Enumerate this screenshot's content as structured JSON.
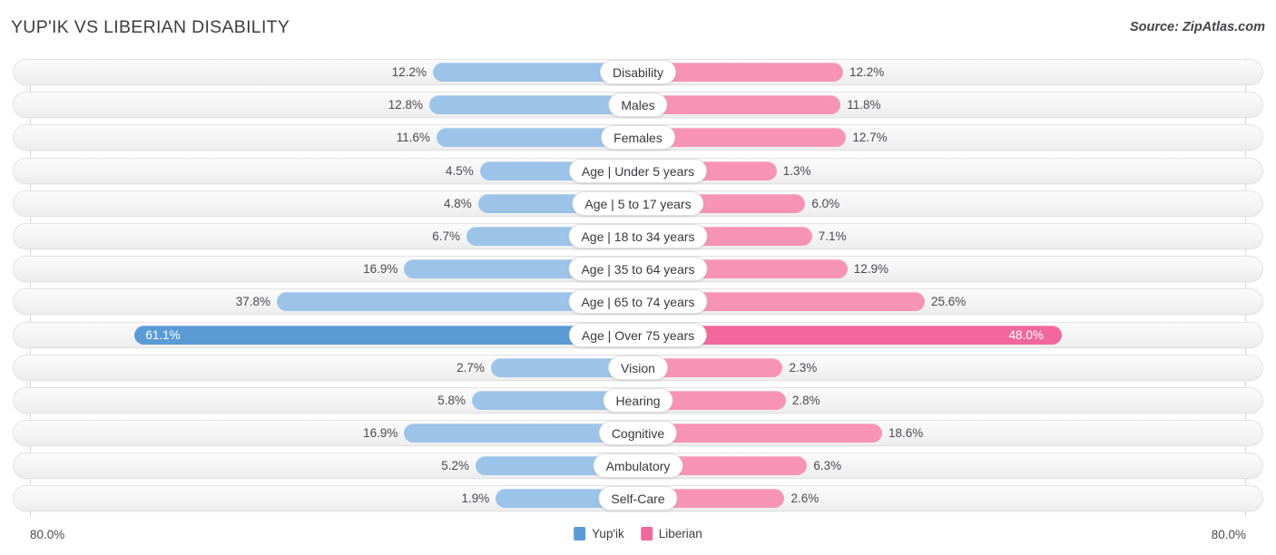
{
  "header": {
    "title": "YUP'IK VS LIBERIAN DISABILITY",
    "source": "Source: ZipAtlas.com"
  },
  "footer": {
    "axis_left": "80.0%",
    "axis_right": "80.0%",
    "legend": [
      {
        "label": "Yup'ik",
        "color": "#5b9bd5"
      },
      {
        "label": "Liberian",
        "color": "#f2689d"
      }
    ]
  },
  "chart_data": {
    "type": "bar",
    "title": "YUP'IK VS LIBERIAN DISABILITY",
    "orientation": "horizontal-diverging",
    "xlabel": "",
    "ylabel": "",
    "axis_max_label": "80.0%",
    "xlim": [
      -80.0,
      80.0
    ],
    "grid": true,
    "legend_position": "bottom-center",
    "series": [
      {
        "name": "Yup'ik",
        "color": "#5b9bd5",
        "bar_color": "#9cc3e8",
        "side": "left",
        "values": [
          12.2,
          12.8,
          11.6,
          4.5,
          4.8,
          6.7,
          16.9,
          37.8,
          61.1,
          2.7,
          5.8,
          16.9,
          5.2,
          1.9
        ],
        "labels": [
          "12.2%",
          "12.8%",
          "11.6%",
          "4.5%",
          "4.8%",
          "6.7%",
          "16.9%",
          "37.8%",
          "61.1%",
          "2.7%",
          "5.8%",
          "16.9%",
          "5.2%",
          "1.9%"
        ]
      },
      {
        "name": "Liberian",
        "color": "#f2689d",
        "bar_color": "#f794b6",
        "side": "right",
        "values": [
          12.2,
          11.8,
          12.7,
          1.3,
          6.0,
          7.1,
          12.9,
          25.6,
          48.0,
          2.3,
          2.8,
          18.6,
          6.3,
          2.6
        ],
        "labels": [
          "12.2%",
          "11.8%",
          "12.7%",
          "1.3%",
          "6.0%",
          "7.1%",
          "12.9%",
          "25.6%",
          "48.0%",
          "2.3%",
          "2.8%",
          "18.6%",
          "6.3%",
          "2.6%"
        ]
      }
    ],
    "categories": [
      "Disability",
      "Males",
      "Females",
      "Age | Under 5 years",
      "Age | 5 to 17 years",
      "Age | 18 to 34 years",
      "Age | 35 to 64 years",
      "Age | 65 to 74 years",
      "Age | Over 75 years",
      "Vision",
      "Hearing",
      "Cognitive",
      "Ambulatory",
      "Self-Care"
    ],
    "highlighted_categories": [
      "Age | Over 75 years"
    ],
    "rows": [
      {
        "label": "Disability",
        "left": 12.2,
        "left_label": "12.2%",
        "right": 12.2,
        "right_label": "12.2%",
        "highlight": false
      },
      {
        "label": "Males",
        "left": 12.8,
        "left_label": "12.8%",
        "right": 11.8,
        "right_label": "11.8%",
        "highlight": false
      },
      {
        "label": "Females",
        "left": 11.6,
        "left_label": "11.6%",
        "right": 12.7,
        "right_label": "12.7%",
        "highlight": false
      },
      {
        "label": "Age | Under 5 years",
        "left": 4.5,
        "left_label": "4.5%",
        "right": 1.3,
        "right_label": "1.3%",
        "highlight": false
      },
      {
        "label": "Age | 5 to 17 years",
        "left": 4.8,
        "left_label": "4.8%",
        "right": 6.0,
        "right_label": "6.0%",
        "highlight": false
      },
      {
        "label": "Age | 18 to 34 years",
        "left": 6.7,
        "left_label": "6.7%",
        "right": 7.1,
        "right_label": "7.1%",
        "highlight": false
      },
      {
        "label": "Age | 35 to 64 years",
        "left": 16.9,
        "left_label": "16.9%",
        "right": 12.9,
        "right_label": "12.9%",
        "highlight": false
      },
      {
        "label": "Age | 65 to 74 years",
        "left": 37.8,
        "left_label": "37.8%",
        "right": 25.6,
        "right_label": "25.6%",
        "highlight": false
      },
      {
        "label": "Age | Over 75 years",
        "left": 61.1,
        "left_label": "61.1%",
        "right": 48.0,
        "right_label": "48.0%",
        "highlight": true
      },
      {
        "label": "Vision",
        "left": 2.7,
        "left_label": "2.7%",
        "right": 2.3,
        "right_label": "2.3%",
        "highlight": false
      },
      {
        "label": "Hearing",
        "left": 5.8,
        "left_label": "5.8%",
        "right": 2.8,
        "right_label": "2.8%",
        "highlight": false
      },
      {
        "label": "Cognitive",
        "left": 16.9,
        "left_label": "16.9%",
        "right": 18.6,
        "right_label": "18.6%",
        "highlight": false
      },
      {
        "label": "Ambulatory",
        "left": 5.2,
        "left_label": "5.2%",
        "right": 6.3,
        "right_label": "6.3%",
        "highlight": false
      },
      {
        "label": "Self-Care",
        "left": 1.9,
        "left_label": "1.9%",
        "right": 2.6,
        "right_label": "2.6%",
        "highlight": false
      }
    ]
  }
}
